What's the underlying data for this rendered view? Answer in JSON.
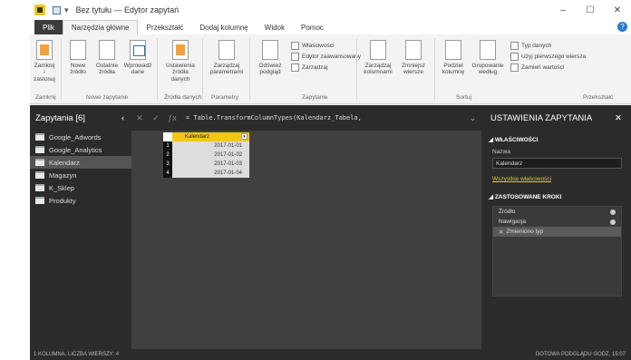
{
  "window": {
    "title": "Bez tytułu — Edytor zapytań",
    "controls": {
      "minimize": "–",
      "maximize": "☐",
      "close": "✕"
    }
  },
  "ribbon_tabs": [
    "Plik",
    "Narzędzia główne",
    "Przekształć",
    "Dodaj kolumnę",
    "Widok",
    "Pomoc"
  ],
  "ribbon": {
    "buttons": [
      {
        "label": "Zamknij i zastosuj",
        "icon": "close-apply-icon"
      },
      {
        "label": "Nowe źródło",
        "icon": "new-source-icon"
      },
      {
        "label": "Ostatnie źródła",
        "icon": "recent-sources-icon"
      },
      {
        "label": "Wprowadź dane",
        "icon": "enter-data-icon"
      },
      {
        "label": "Ustawienia źródła danych",
        "icon": "data-source-settings-icon"
      },
      {
        "label": "Zarządzaj parametrami",
        "icon": "manage-parameters-icon"
      },
      {
        "label": "Odśwież podgląd",
        "icon": "refresh-preview-icon"
      }
    ],
    "small": [
      "Właściwości",
      "Edytor zaawansowany",
      "Zarządzaj"
    ],
    "right_buttons": [
      "Zarządzaj kolumnami",
      "Zmniejsz wiersze",
      "Podziel kolumnę",
      "Grupowanie według"
    ],
    "right_small": [
      "Typ danych",
      "Użyj pierwszego wiersza",
      "Zamień wartości"
    ],
    "groups": [
      "Zamknij",
      "Nowe zapytanie",
      "Źródła danych",
      "Parametry",
      "Zapytanie",
      "Sortuj",
      "Przekształć"
    ]
  },
  "queries_panel": {
    "title": "Zapytania [6]",
    "items": [
      "Google_Adwords",
      "Google_Analytics",
      "Kalendarz",
      "Magazyn",
      "K_Sklep",
      "Produkty"
    ],
    "selected_index": 2
  },
  "formula_bar": {
    "text": "= Table.TransformColumnTypes(Kalendarz_Tabela,"
  },
  "grid": {
    "column_header": "Kalendarz",
    "rows": [
      {
        "n": "1",
        "value": "2017-01-01"
      },
      {
        "n": "2",
        "value": "2017-01-02"
      },
      {
        "n": "3",
        "value": "2017-01-03"
      },
      {
        "n": "4",
        "value": "2017-01-04"
      }
    ]
  },
  "settings_panel": {
    "title": "USTAWIENIA ZAPYTANIA",
    "properties_header": "WŁAŚCIWOŚCI",
    "name_label": "Nazwa",
    "name_value": "Kalendarz",
    "all_properties": "Wszystkie właściwości",
    "steps_header": "ZASTOSOWANE KROKI",
    "steps": [
      "Źródło",
      "Nawigacja",
      "Zmieniono typ"
    ],
    "selected_step": 2
  },
  "status": {
    "left": "1 KOLUMNA, LICZBA WIERSZY: 4",
    "right": "GOTOWA PODGLĄDU GODZ. 15:07"
  }
}
